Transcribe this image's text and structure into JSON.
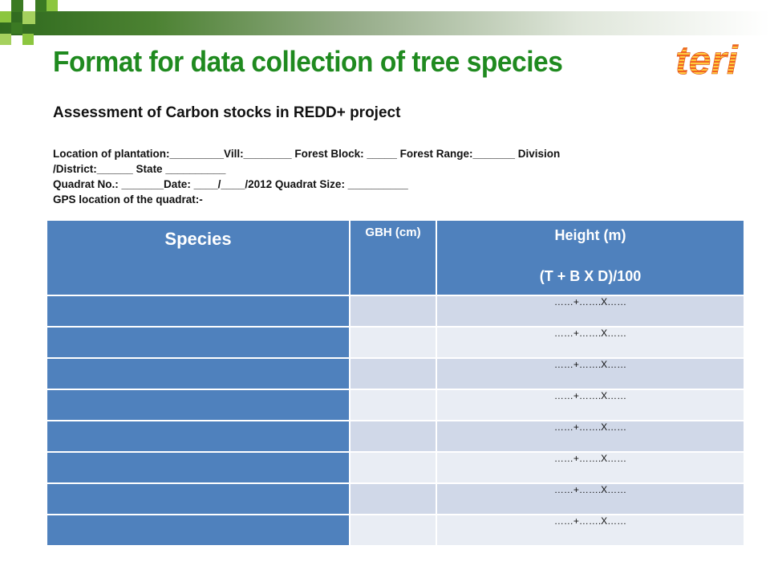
{
  "title": "Format for data collection of tree species",
  "subtitle": "Assessment of Carbon stocks in REDD+ project",
  "logo_text": "teri",
  "form_lines": [
    "Location of plantation:_________Vill:________ Forest  Block: _____ Forest Range:_______ Division",
    "/District:______ State __________",
    "Quadrat  No.: _______Date: ____/____/2012 Quadrat Size: __________",
    "GPS location of the quadrat:-"
  ],
  "table": {
    "headers": {
      "species": "Species",
      "gbh": "GBH (cm)",
      "height": "Height (m)",
      "height_formula": "(T + B X D)/100"
    },
    "rows": [
      {
        "species": "",
        "gbh": "",
        "formula": "……+…….X……"
      },
      {
        "species": "",
        "gbh": "",
        "formula": "……+…….X……"
      },
      {
        "species": "",
        "gbh": "",
        "formula": "……+…….X……"
      },
      {
        "species": "",
        "gbh": "",
        "formula": "……+…….X……"
      },
      {
        "species": "",
        "gbh": "",
        "formula": "……+…….X……"
      },
      {
        "species": "",
        "gbh": "",
        "formula": "……+…….X……"
      },
      {
        "species": "",
        "gbh": "",
        "formula": "……+…….X……"
      },
      {
        "species": "",
        "gbh": "",
        "formula": "……+…….X……"
      }
    ]
  },
  "colors": {
    "title": "#1f8a1f",
    "header_blue": "#4f81bd",
    "row_dark": "#d0d8e8",
    "row_light": "#e9edf4",
    "logo_orange": "#f26522"
  }
}
